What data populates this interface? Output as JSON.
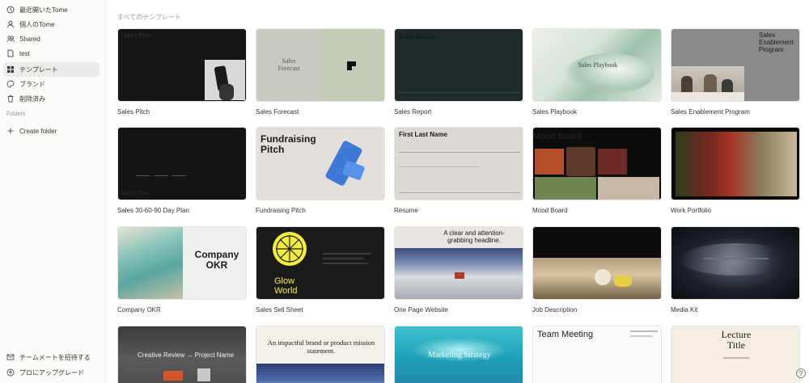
{
  "sidebar": {
    "items": [
      {
        "label": "最近開いたTome",
        "icon": "clock-icon"
      },
      {
        "label": "個人のTome",
        "icon": "person-icon"
      },
      {
        "label": "Shared",
        "icon": "people-icon"
      },
      {
        "label": "test",
        "icon": "file-icon"
      },
      {
        "label": "テンプレート",
        "icon": "grid-icon",
        "active": true
      },
      {
        "label": "ブランド",
        "icon": "palette-icon"
      },
      {
        "label": "削除済み",
        "icon": "trash-icon"
      }
    ],
    "folders_heading": "Folders",
    "create_folder": "Create folder",
    "invite": "チームメートを招待する",
    "upgrade": "プロにアップグレード"
  },
  "main": {
    "section_title": "すべてのテンプレート",
    "help": "?",
    "templates": [
      {
        "label": "Sales Pitch",
        "thumb_text": "Sales Pitch"
      },
      {
        "label": "Sales Forecast",
        "thumb_text": "Sales\nForecast"
      },
      {
        "label": "Sales Report",
        "thumb_text": "Sales Report"
      },
      {
        "label": "Sales Playbook",
        "thumb_text": "Sales Playbook"
      },
      {
        "label": "Sales Enablement Program",
        "thumb_text": "Sales\nEnablement\nProgram"
      },
      {
        "label": "Sales 30-60-90 Day Plan",
        "thumb_text": "Sales Plan"
      },
      {
        "label": "Fundraising Pitch",
        "thumb_text": "Fundraising\nPitch"
      },
      {
        "label": "Resume",
        "thumb_text": "First Last Name"
      },
      {
        "label": "Mood Board",
        "thumb_text": "Mood Board"
      },
      {
        "label": "Work Portfolio",
        "thumb_text": ""
      },
      {
        "label": "Company OKR",
        "thumb_text": "Company\nOKR"
      },
      {
        "label": "Sales Sell Sheet",
        "thumb_text": "Glow\nWorld"
      },
      {
        "label": "One Page Website",
        "thumb_text": "A clear and attention-\ngrabbing headline."
      },
      {
        "label": "Job Description",
        "thumb_text": ""
      },
      {
        "label": "Media Kit",
        "thumb_text": ""
      },
      {
        "label": "",
        "thumb_text": "Creative Review → Project Name"
      },
      {
        "label": "",
        "thumb_text": "An impactful brand or product mission statement."
      },
      {
        "label": "",
        "thumb_text": "Marketing Strategy"
      },
      {
        "label": "",
        "thumb_text": "Team Meeting"
      },
      {
        "label": "",
        "thumb_text": "Lecture\nTitle"
      }
    ]
  },
  "colors": {
    "sidebar_bg": "#fbfbfa",
    "active_item_bg": "#ebebea",
    "glow_yellow": "#f3ee3a"
  }
}
